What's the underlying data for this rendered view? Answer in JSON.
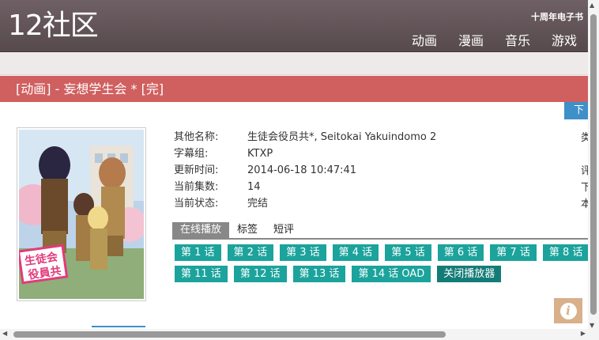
{
  "header": {
    "logo": "12社区",
    "ebook": "十周年电子书",
    "nav": [
      "动画",
      "漫画",
      "音乐",
      "游戏"
    ]
  },
  "title": "[动画] - 妄想学生会 * [完]",
  "download_button": "下",
  "details": [
    {
      "label": "其他名称:",
      "value": "生徒会役员共*, Seitokai Yakuindomo 2"
    },
    {
      "label": "字幕组:",
      "value": "KTXP"
    },
    {
      "label": "更新时间:",
      "value": "2014-06-18 10:47:41"
    },
    {
      "label": "当前集数:",
      "value": "14"
    },
    {
      "label": "当前状态:",
      "value": "完结"
    }
  ],
  "right_cut": [
    "类",
    "评",
    "下",
    "本"
  ],
  "tabs": [
    "在线播放",
    "标签",
    "短评"
  ],
  "episodes_row1": [
    "第 1 话",
    "第 2 话",
    "第 3 话",
    "第 4 话",
    "第 5 话",
    "第 6 话",
    "第 7 话",
    "第 8 话"
  ],
  "episodes_row2": [
    "第 11 话",
    "第 12 话",
    "第 13 话",
    "第 14 话 OAD"
  ],
  "close_player": "关闭播放器",
  "info_icon": "i",
  "colors": {
    "header": "#5f5255",
    "title_bar": "#d05f5f",
    "episode": "#1ba39c",
    "close_player": "#147c77",
    "download": "#3f8fc8"
  }
}
